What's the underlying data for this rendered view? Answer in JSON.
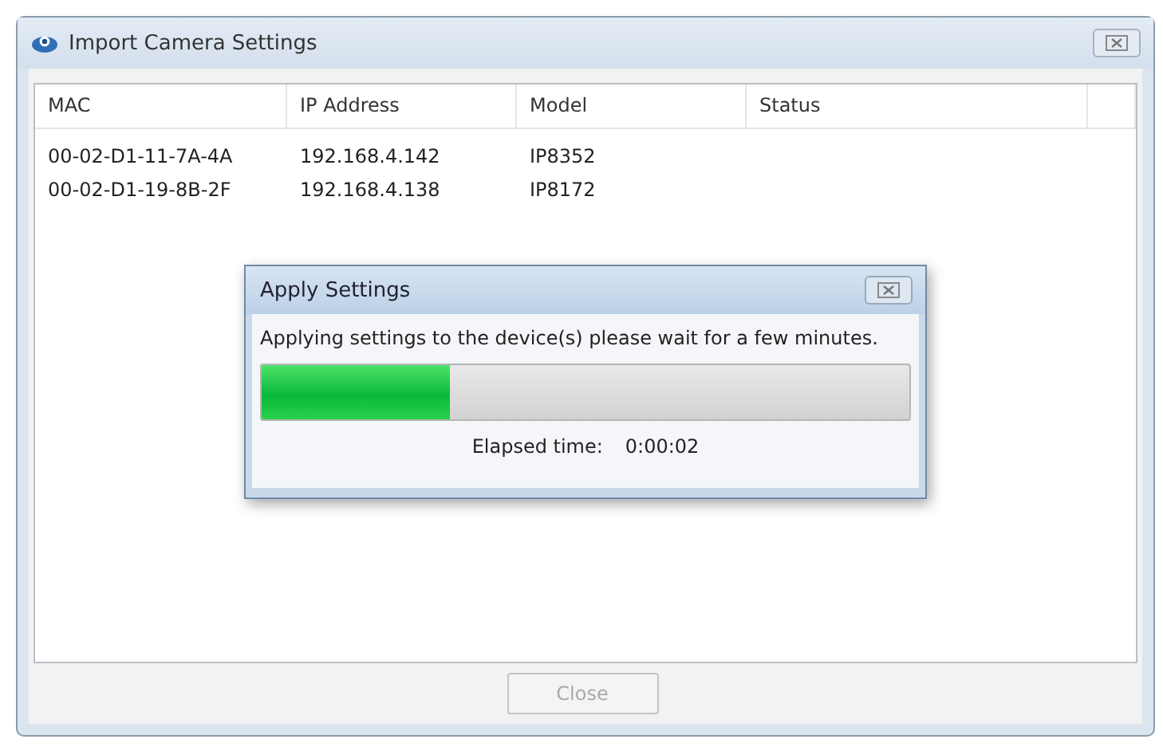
{
  "window": {
    "title": "Import Camera Settings"
  },
  "table": {
    "columns": [
      "MAC",
      "IP Address",
      "Model",
      "Status"
    ],
    "rows": [
      [
        "00-02-D1-11-7A-4A",
        "192.168.4.142",
        "IP8352"
      ],
      [
        "00-02-D1-19-8B-2F",
        "192.168.4.138",
        "IP8172"
      ]
    ]
  },
  "dialog": {
    "title": "Apply Settings",
    "message": "Applying settings to the device(s) please wait for a few minutes.",
    "progress": {
      "level": 0.29
    },
    "elapsed_label": "Elapsed time:",
    "elapsed_value": "0:00:02"
  },
  "buttons": [
    {
      "label": "Close",
      "disabled": true
    }
  ]
}
